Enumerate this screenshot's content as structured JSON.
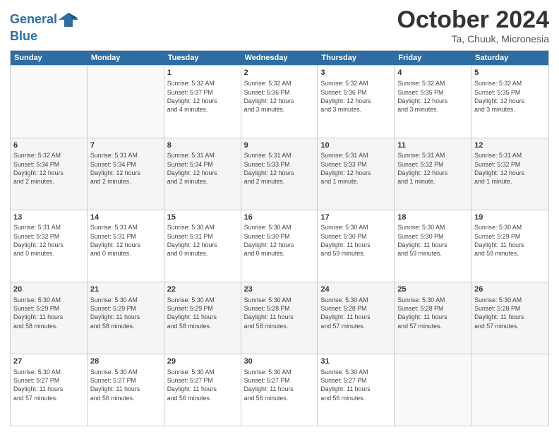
{
  "logo": {
    "line1": "General",
    "line2": "Blue"
  },
  "title": "October 2024",
  "location": "Ta, Chuuk, Micronesia",
  "header_days": [
    "Sunday",
    "Monday",
    "Tuesday",
    "Wednesday",
    "Thursday",
    "Friday",
    "Saturday"
  ],
  "rows": [
    [
      {
        "day": "",
        "info": ""
      },
      {
        "day": "",
        "info": ""
      },
      {
        "day": "1",
        "info": "Sunrise: 5:32 AM\nSunset: 5:37 PM\nDaylight: 12 hours\nand 4 minutes."
      },
      {
        "day": "2",
        "info": "Sunrise: 5:32 AM\nSunset: 5:36 PM\nDaylight: 12 hours\nand 3 minutes."
      },
      {
        "day": "3",
        "info": "Sunrise: 5:32 AM\nSunset: 5:36 PM\nDaylight: 12 hours\nand 3 minutes."
      },
      {
        "day": "4",
        "info": "Sunrise: 5:32 AM\nSunset: 5:35 PM\nDaylight: 12 hours\nand 3 minutes."
      },
      {
        "day": "5",
        "info": "Sunrise: 5:32 AM\nSunset: 5:35 PM\nDaylight: 12 hours\nand 3 minutes."
      }
    ],
    [
      {
        "day": "6",
        "info": "Sunrise: 5:32 AM\nSunset: 5:34 PM\nDaylight: 12 hours\nand 2 minutes."
      },
      {
        "day": "7",
        "info": "Sunrise: 5:31 AM\nSunset: 5:34 PM\nDaylight: 12 hours\nand 2 minutes."
      },
      {
        "day": "8",
        "info": "Sunrise: 5:31 AM\nSunset: 5:34 PM\nDaylight: 12 hours\nand 2 minutes."
      },
      {
        "day": "9",
        "info": "Sunrise: 5:31 AM\nSunset: 5:33 PM\nDaylight: 12 hours\nand 2 minutes."
      },
      {
        "day": "10",
        "info": "Sunrise: 5:31 AM\nSunset: 5:33 PM\nDaylight: 12 hours\nand 1 minute."
      },
      {
        "day": "11",
        "info": "Sunrise: 5:31 AM\nSunset: 5:32 PM\nDaylight: 12 hours\nand 1 minute."
      },
      {
        "day": "12",
        "info": "Sunrise: 5:31 AM\nSunset: 5:32 PM\nDaylight: 12 hours\nand 1 minute."
      }
    ],
    [
      {
        "day": "13",
        "info": "Sunrise: 5:31 AM\nSunset: 5:32 PM\nDaylight: 12 hours\nand 0 minutes."
      },
      {
        "day": "14",
        "info": "Sunrise: 5:31 AM\nSunset: 5:31 PM\nDaylight: 12 hours\nand 0 minutes."
      },
      {
        "day": "15",
        "info": "Sunrise: 5:30 AM\nSunset: 5:31 PM\nDaylight: 12 hours\nand 0 minutes."
      },
      {
        "day": "16",
        "info": "Sunrise: 5:30 AM\nSunset: 5:30 PM\nDaylight: 12 hours\nand 0 minutes."
      },
      {
        "day": "17",
        "info": "Sunrise: 5:30 AM\nSunset: 5:30 PM\nDaylight: 11 hours\nand 59 minutes."
      },
      {
        "day": "18",
        "info": "Sunrise: 5:30 AM\nSunset: 5:30 PM\nDaylight: 11 hours\nand 59 minutes."
      },
      {
        "day": "19",
        "info": "Sunrise: 5:30 AM\nSunset: 5:29 PM\nDaylight: 11 hours\nand 59 minutes."
      }
    ],
    [
      {
        "day": "20",
        "info": "Sunrise: 5:30 AM\nSunset: 5:29 PM\nDaylight: 11 hours\nand 58 minutes."
      },
      {
        "day": "21",
        "info": "Sunrise: 5:30 AM\nSunset: 5:29 PM\nDaylight: 11 hours\nand 58 minutes."
      },
      {
        "day": "22",
        "info": "Sunrise: 5:30 AM\nSunset: 5:29 PM\nDaylight: 11 hours\nand 58 minutes."
      },
      {
        "day": "23",
        "info": "Sunrise: 5:30 AM\nSunset: 5:28 PM\nDaylight: 11 hours\nand 58 minutes."
      },
      {
        "day": "24",
        "info": "Sunrise: 5:30 AM\nSunset: 5:28 PM\nDaylight: 11 hours\nand 57 minutes."
      },
      {
        "day": "25",
        "info": "Sunrise: 5:30 AM\nSunset: 5:28 PM\nDaylight: 11 hours\nand 57 minutes."
      },
      {
        "day": "26",
        "info": "Sunrise: 5:30 AM\nSunset: 5:28 PM\nDaylight: 11 hours\nand 57 minutes."
      }
    ],
    [
      {
        "day": "27",
        "info": "Sunrise: 5:30 AM\nSunset: 5:27 PM\nDaylight: 11 hours\nand 57 minutes."
      },
      {
        "day": "28",
        "info": "Sunrise: 5:30 AM\nSunset: 5:27 PM\nDaylight: 11 hours\nand 56 minutes."
      },
      {
        "day": "29",
        "info": "Sunrise: 5:30 AM\nSunset: 5:27 PM\nDaylight: 11 hours\nand 56 minutes."
      },
      {
        "day": "30",
        "info": "Sunrise: 5:30 AM\nSunset: 5:27 PM\nDaylight: 11 hours\nand 56 minutes."
      },
      {
        "day": "31",
        "info": "Sunrise: 5:30 AM\nSunset: 5:27 PM\nDaylight: 11 hours\nand 56 minutes."
      },
      {
        "day": "",
        "info": ""
      },
      {
        "day": "",
        "info": ""
      }
    ]
  ]
}
